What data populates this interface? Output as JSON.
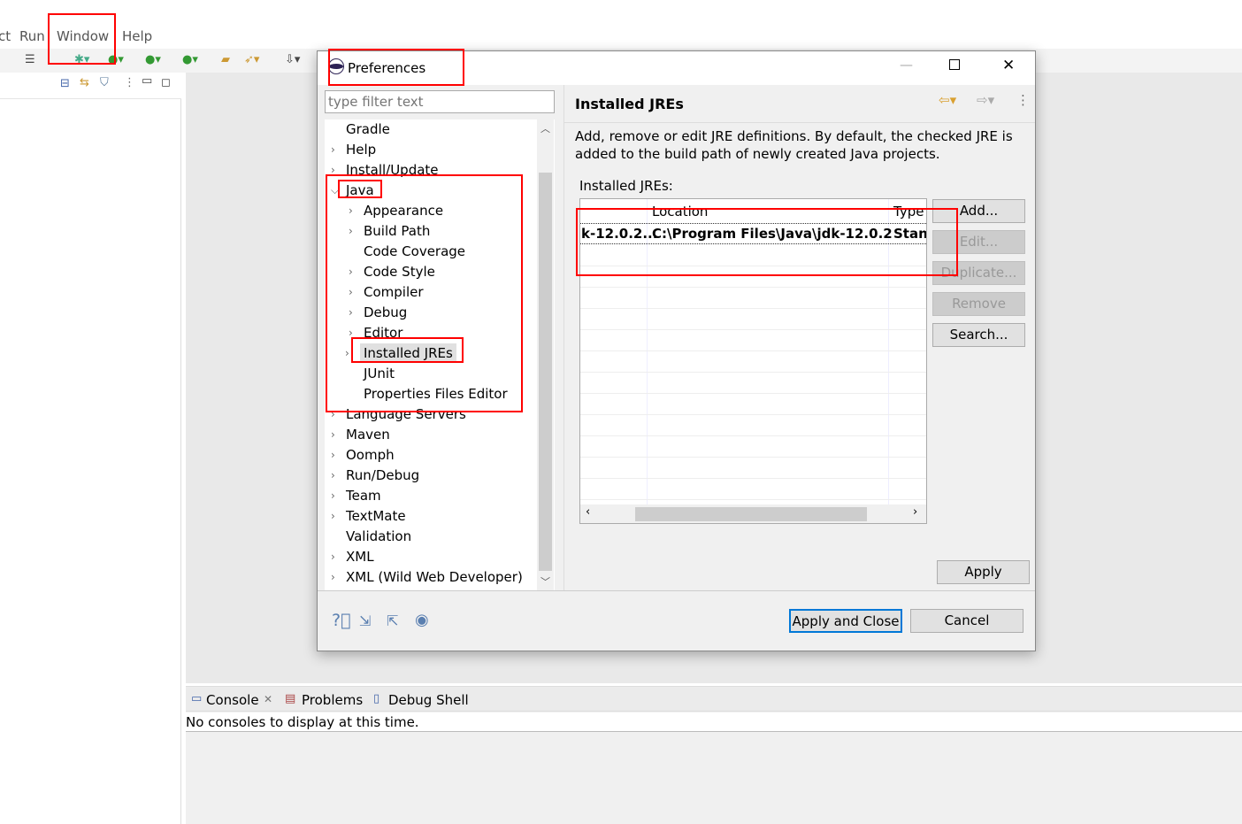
{
  "menu": {
    "items": [
      "ct",
      "Run",
      "Window",
      "Help"
    ]
  },
  "dialog": {
    "title": "Preferences",
    "filter_placeholder": "type filter text",
    "tree": [
      {
        "label": "Gradle",
        "expandable": false,
        "level": 0
      },
      {
        "label": "Help",
        "expandable": true,
        "level": 0
      },
      {
        "label": "Install/Update",
        "expandable": true,
        "level": 0
      },
      {
        "label": "Java",
        "expandable": true,
        "expanded": true,
        "level": 0
      },
      {
        "label": "Appearance",
        "expandable": true,
        "level": 1
      },
      {
        "label": "Build Path",
        "expandable": true,
        "level": 1
      },
      {
        "label": "Code Coverage",
        "expandable": false,
        "level": 1
      },
      {
        "label": "Code Style",
        "expandable": true,
        "level": 1
      },
      {
        "label": "Compiler",
        "expandable": true,
        "level": 1
      },
      {
        "label": "Debug",
        "expandable": true,
        "level": 1
      },
      {
        "label": "Editor",
        "expandable": true,
        "level": 1
      },
      {
        "label": "Installed JREs",
        "expandable": true,
        "level": 1,
        "selected": true
      },
      {
        "label": "JUnit",
        "expandable": false,
        "level": 1
      },
      {
        "label": "Properties Files Editor",
        "expandable": false,
        "level": 1
      },
      {
        "label": "Language Servers",
        "expandable": true,
        "level": 0
      },
      {
        "label": "Maven",
        "expandable": true,
        "level": 0
      },
      {
        "label": "Oomph",
        "expandable": true,
        "level": 0
      },
      {
        "label": "Run/Debug",
        "expandable": true,
        "level": 0
      },
      {
        "label": "Team",
        "expandable": true,
        "level": 0
      },
      {
        "label": "TextMate",
        "expandable": true,
        "level": 0
      },
      {
        "label": "Validation",
        "expandable": false,
        "level": 0
      },
      {
        "label": "XML",
        "expandable": true,
        "level": 0
      },
      {
        "label": "XML (Wild Web Developer)",
        "expandable": true,
        "level": 0
      }
    ],
    "page_title": "Installed JREs",
    "description": "Add, remove or edit JRE definitions. By default, the checked JRE is added to the build path of newly created Java projects.",
    "list_label": "Installed JREs:",
    "table": {
      "columns": [
        "",
        "Location",
        "Type"
      ],
      "rows": [
        [
          "k-12.0.2...",
          "C:\\Program Files\\Java\\jdk-12.0.2",
          "Stan"
        ]
      ]
    },
    "buttons": {
      "add": "Add...",
      "edit": "Edit...",
      "duplicate": "Duplicate...",
      "remove": "Remove",
      "search": "Search...",
      "apply": "Apply",
      "apply_close": "Apply and Close",
      "cancel": "Cancel"
    }
  },
  "console": {
    "tabs": [
      "Console",
      "Problems",
      "Debug Shell"
    ],
    "message": "No consoles to display at this time."
  },
  "colors": {
    "annotation": "#ff0000",
    "selection": "#e0e0e0"
  }
}
